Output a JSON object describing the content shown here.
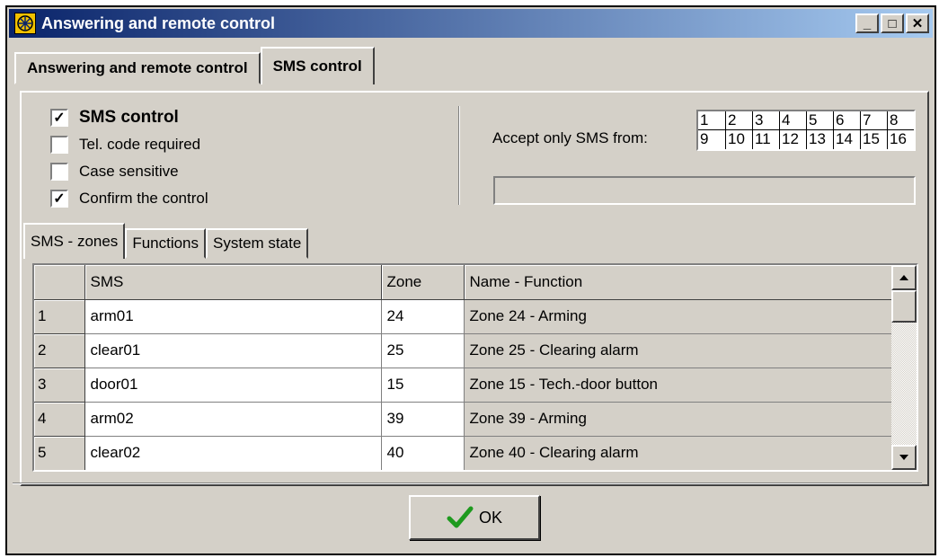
{
  "window": {
    "title": "Answering and remote control",
    "controls": {
      "minimize": "_",
      "maximize": "□",
      "close": "✕"
    }
  },
  "tabs": [
    {
      "label": "Answering and remote control",
      "active": false
    },
    {
      "label": "SMS control",
      "active": true
    }
  ],
  "options": [
    {
      "label": "SMS control",
      "checked": true
    },
    {
      "label": "Tel. code required",
      "checked": false
    },
    {
      "label": "Case sensitive",
      "checked": false
    },
    {
      "label": "Confirm the control",
      "checked": true
    }
  ],
  "accept": {
    "label": "Accept only SMS from:",
    "numbers": [
      "1",
      "2",
      "3",
      "4",
      "5",
      "6",
      "7",
      "8",
      "9",
      "10",
      "11",
      "12",
      "13",
      "14",
      "15",
      "16"
    ],
    "field_value": ""
  },
  "subtabs": [
    {
      "label": "SMS - zones",
      "active": true
    },
    {
      "label": "Functions",
      "active": false
    },
    {
      "label": "System state",
      "active": false
    }
  ],
  "grid": {
    "columns": [
      "",
      "SMS",
      "Zone",
      "Name - Function"
    ],
    "rows": [
      {
        "n": "1",
        "sms": "arm01",
        "zone": "24",
        "name": "Zone 24 - Arming"
      },
      {
        "n": "2",
        "sms": "clear01",
        "zone": "25",
        "name": "Zone 25 - Clearing alarm"
      },
      {
        "n": "3",
        "sms": "door01",
        "zone": "15",
        "name": "Zone 15 - Tech.-door button"
      },
      {
        "n": "4",
        "sms": "arm02",
        "zone": "39",
        "name": "Zone 39 - Arming"
      },
      {
        "n": "5",
        "sms": "clear02",
        "zone": "40",
        "name": "Zone 40 - Clearing alarm"
      }
    ]
  },
  "footer": {
    "ok_label": "OK",
    "ok_icon": "checkmark-icon"
  },
  "colors": {
    "titlebar_start": "#0a246a",
    "titlebar_end": "#a6caf0",
    "face": "#d4d0c8",
    "check_green": "#1e9a1e"
  }
}
